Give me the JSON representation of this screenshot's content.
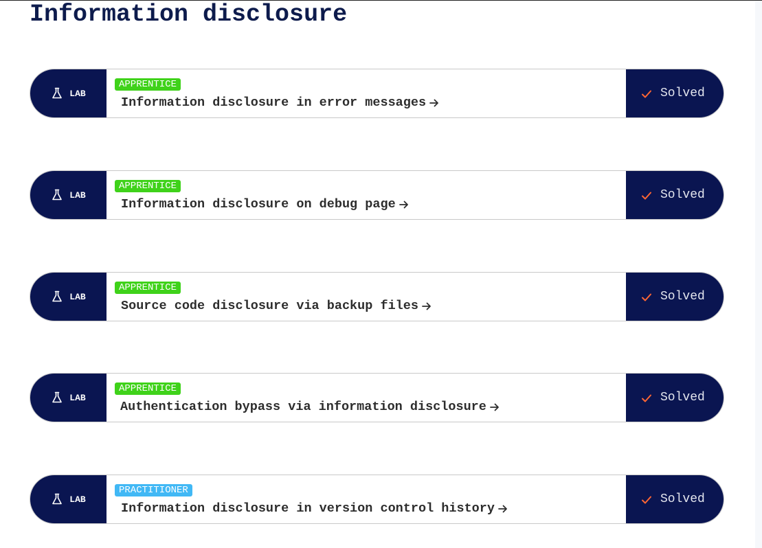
{
  "page": {
    "title": "Information disclosure"
  },
  "colors": {
    "navy": "#0a1551",
    "title_navy": "#0d1b4c",
    "apprentice_green": "#3fd21a",
    "practitioner_blue": "#41b8f5",
    "check_orange": "#ff6633"
  },
  "labs": [
    {
      "kind_label": "LAB",
      "kind_icon": "flask-icon",
      "level": "APPRENTICE",
      "title": "Information disclosure in error messages",
      "status": "Solved",
      "status_icon": "check-icon"
    },
    {
      "kind_label": "LAB",
      "kind_icon": "flask-icon",
      "level": "APPRENTICE",
      "title": "Information disclosure on debug page",
      "status": "Solved",
      "status_icon": "check-icon"
    },
    {
      "kind_label": "LAB",
      "kind_icon": "flask-icon",
      "level": "APPRENTICE",
      "title": "Source code disclosure via backup files",
      "status": "Solved",
      "status_icon": "check-icon"
    },
    {
      "kind_label": "LAB",
      "kind_icon": "flask-icon",
      "level": "APPRENTICE",
      "title": "Authentication bypass via information disclosure",
      "status": "Solved",
      "status_icon": "check-icon"
    },
    {
      "kind_label": "LAB",
      "kind_icon": "flask-icon",
      "level": "PRACTITIONER",
      "title": "Information disclosure in version control history",
      "status": "Solved",
      "status_icon": "check-icon"
    }
  ]
}
